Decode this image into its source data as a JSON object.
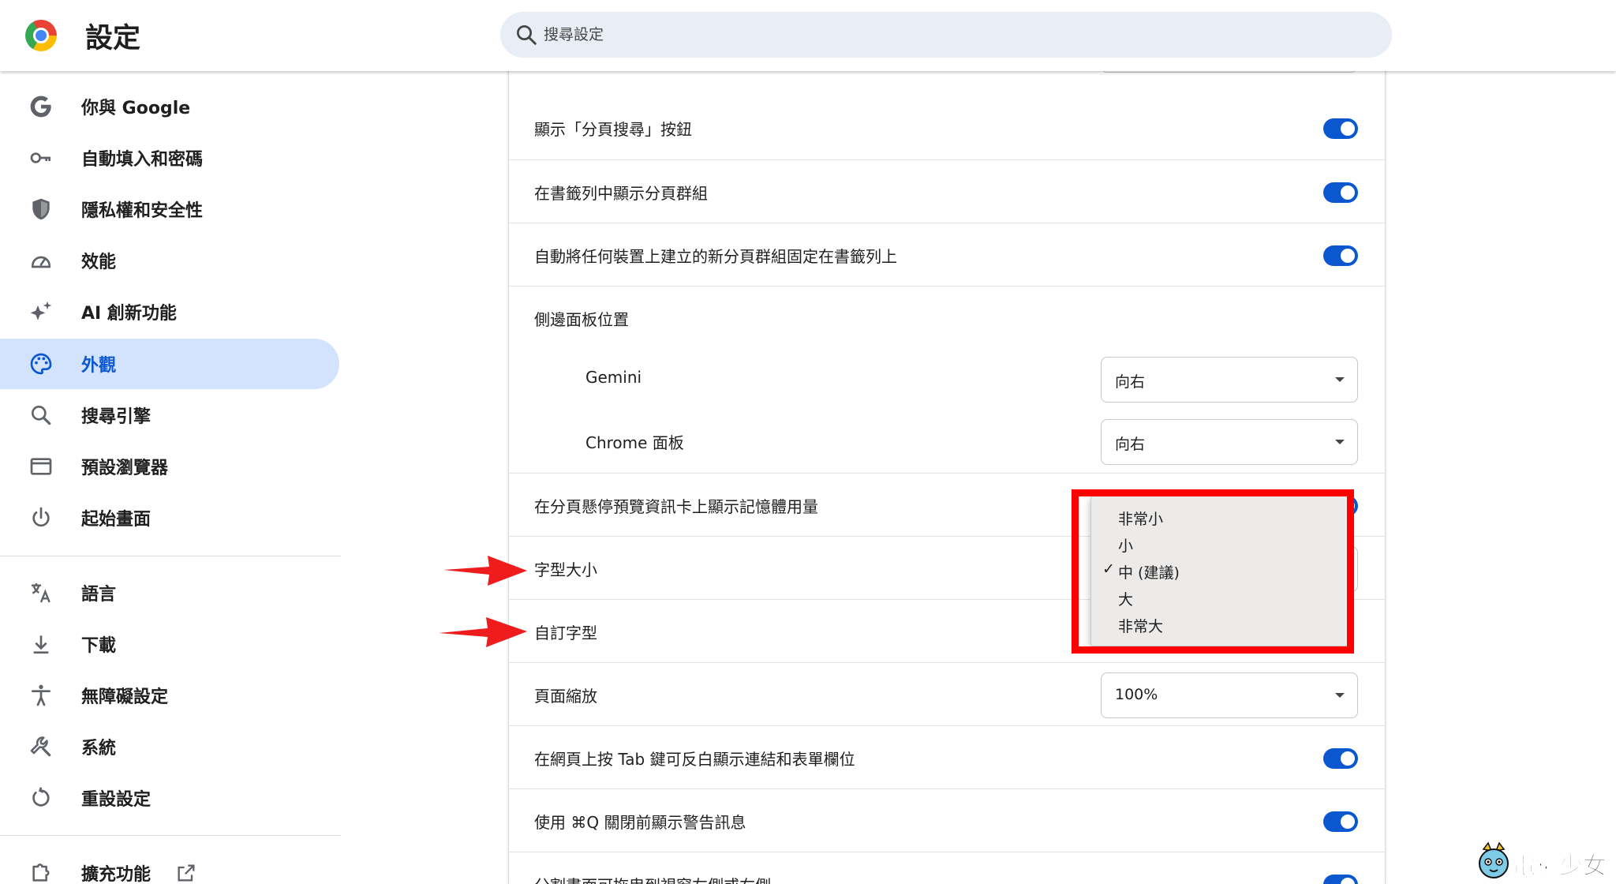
{
  "header": {
    "title": "設定",
    "search_placeholder": "搜尋設定"
  },
  "sidebar": {
    "items": [
      {
        "label": "你與 Google",
        "icon": "google-g-icon"
      },
      {
        "label": "自動填入和密碼",
        "icon": "key-icon"
      },
      {
        "label": "隱私權和安全性",
        "icon": "shield-icon"
      },
      {
        "label": "效能",
        "icon": "speedometer-icon"
      },
      {
        "label": "AI 創新功能",
        "icon": "sparkle-icon"
      },
      {
        "label": "外觀",
        "icon": "palette-icon",
        "active": true
      },
      {
        "label": "搜尋引擎",
        "icon": "search-icon"
      },
      {
        "label": "預設瀏覽器",
        "icon": "browser-window-icon"
      },
      {
        "label": "起始畫面",
        "icon": "power-icon"
      },
      {
        "label": "語言",
        "icon": "translate-icon"
      },
      {
        "label": "下載",
        "icon": "download-icon"
      },
      {
        "label": "無障礙設定",
        "icon": "accessibility-icon"
      },
      {
        "label": "系統",
        "icon": "wrench-icon"
      },
      {
        "label": "重設設定",
        "icon": "reset-icon"
      },
      {
        "label": "擴充功能",
        "icon": "puzzle-icon"
      }
    ]
  },
  "main": {
    "rows": [
      {
        "label": "顯示「分頁搜尋」按鈕",
        "control": "toggle",
        "on": true
      },
      {
        "label": "在書籤列中顯示分頁群組",
        "control": "toggle",
        "on": true
      },
      {
        "label": "自動將任何裝置上建立的新分頁群組固定在書籤列上",
        "control": "toggle",
        "on": true
      },
      {
        "label": "側邊面板位置",
        "control": "none"
      },
      {
        "label": "Gemini",
        "control": "select",
        "value": "向右"
      },
      {
        "label": "Chrome 面板",
        "control": "select",
        "value": "向右"
      },
      {
        "label": "在分頁懸停預覽資訊卡上顯示記憶體用量",
        "control": "toggle",
        "on": true
      },
      {
        "label": "字型大小",
        "control": "select"
      },
      {
        "label": "自訂字型",
        "control": "link"
      },
      {
        "label": "頁面縮放",
        "control": "select",
        "value": "100%"
      },
      {
        "label": "在網頁上按 Tab 鍵可反白顯示連結和表單欄位",
        "control": "toggle",
        "on": true
      },
      {
        "label": "使用 ⌘Q 關閉前顯示警告訊息",
        "control": "toggle",
        "on": true
      },
      {
        "label": "分割畫面可拖曳到視窗左側或右側",
        "control": "toggle",
        "on": true
      }
    ]
  },
  "font_size_dropdown": {
    "options": [
      "非常小",
      "小",
      "中 (建議)",
      "大",
      "非常大"
    ],
    "selected": "中 (建議)",
    "check_mark": "✓"
  },
  "watermark": {
    "text": "電獺少女"
  },
  "colors": {
    "accent": "#0b57d0",
    "active_nav_bg": "#d3e3fd",
    "annotation_red": "#ff0000"
  }
}
